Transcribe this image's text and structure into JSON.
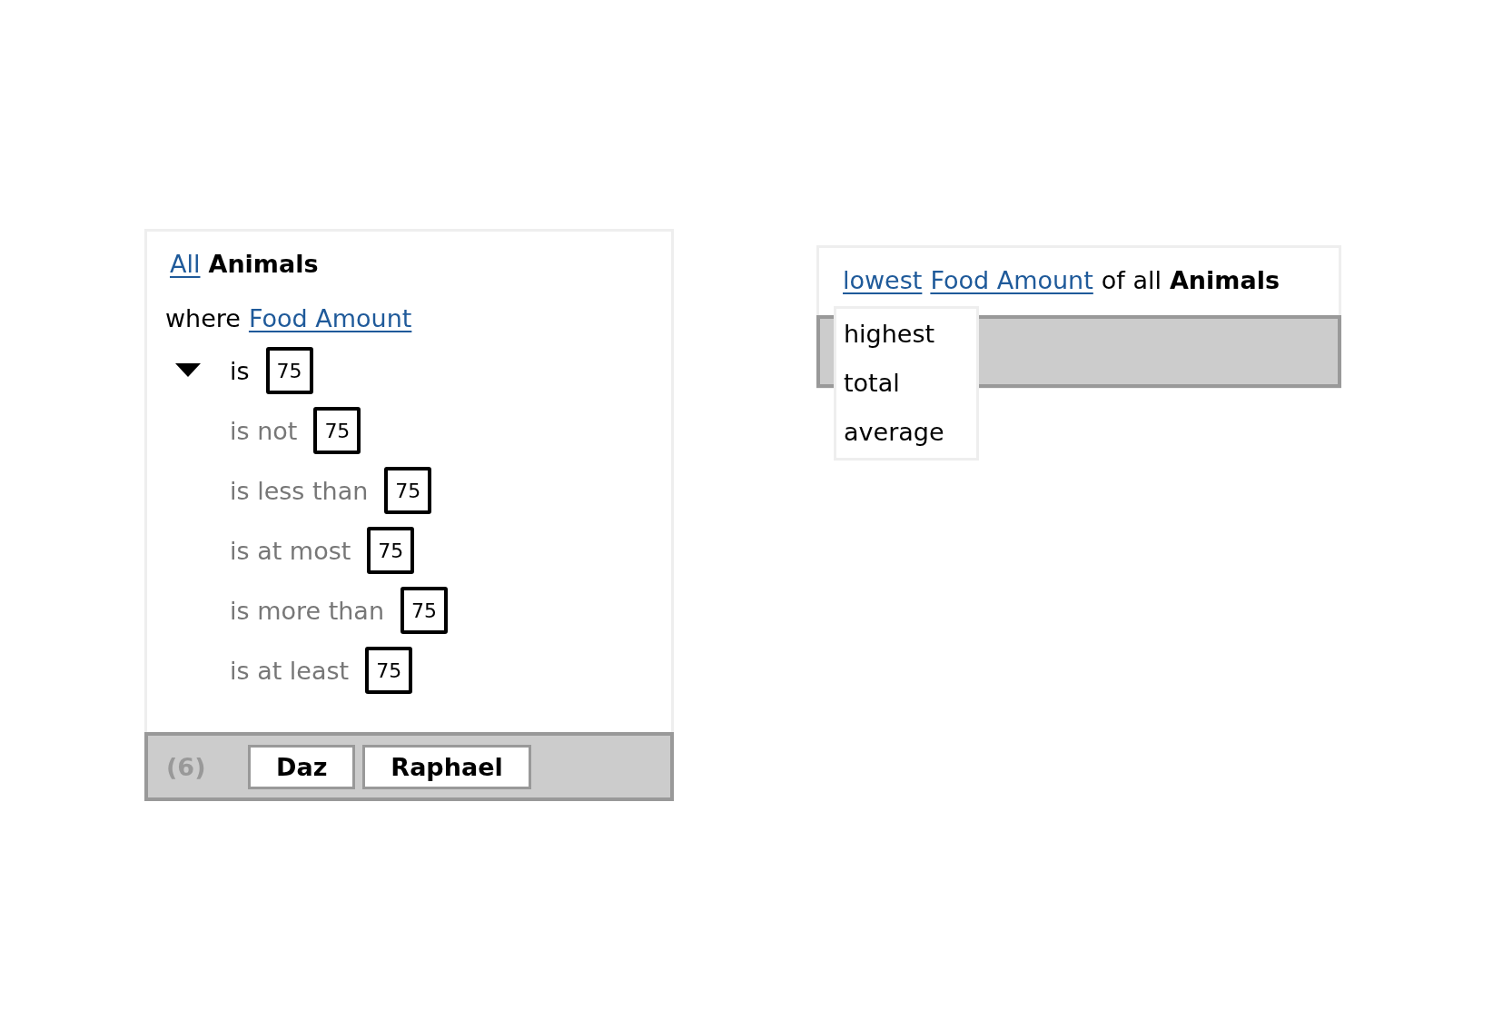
{
  "filter_panel": {
    "header": {
      "link": "All",
      "entity": "Animals"
    },
    "where": {
      "prefix": "where",
      "field": "Food Amount"
    },
    "operators": [
      {
        "label": "is",
        "value": "75",
        "selected": true
      },
      {
        "label": "is not",
        "value": "75",
        "selected": false
      },
      {
        "label": "is less than",
        "value": "75",
        "selected": false
      },
      {
        "label": "is at most",
        "value": "75",
        "selected": false
      },
      {
        "label": "is more than",
        "value": "75",
        "selected": false
      },
      {
        "label": "is at least",
        "value": "75",
        "selected": false
      }
    ],
    "footer": {
      "count": "(6)",
      "chips": [
        "Daz",
        "Raphael"
      ]
    }
  },
  "aggregate_panel": {
    "function": "lowest",
    "field": "Food Amount",
    "connector": "of all",
    "entity": "Animals",
    "menu": [
      "highest",
      "total",
      "average"
    ]
  }
}
